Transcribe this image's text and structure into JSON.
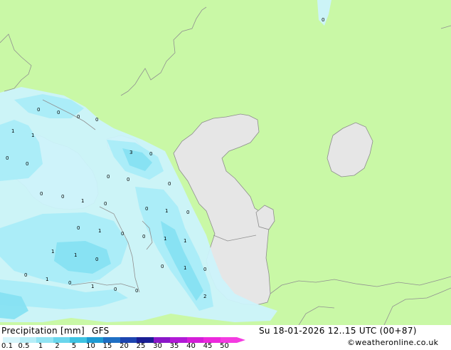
{
  "title": "Precipitation [mm]",
  "model": "GFS",
  "datetime": "Su 18-01-2026 12..15 UTC (00+87)",
  "credit": "©weatheronline.co.uk",
  "colorbar": {
    "labels": [
      "0.1",
      "0.5",
      "1",
      "2",
      "5",
      "10",
      "15",
      "20",
      "25",
      "30",
      "35",
      "40",
      "45",
      "50"
    ],
    "colors": [
      "#d6f5fb",
      "#b6eef8",
      "#92e4f3",
      "#6ad6ec",
      "#3fc3e2",
      "#1e9bd3",
      "#1f6fc4",
      "#1d45b0",
      "#1a1e94",
      "#8a17c8",
      "#b11ad6",
      "#d41ed8",
      "#ec28dd",
      "#f43be1"
    ]
  },
  "map_values": [
    {
      "label": "0"
    },
    {
      "label": "0"
    },
    {
      "label": "0"
    },
    {
      "label": "0"
    },
    {
      "label": "1"
    },
    {
      "label": "1"
    },
    {
      "label": "0"
    },
    {
      "label": "0"
    },
    {
      "label": "3"
    },
    {
      "label": "0"
    },
    {
      "label": "0"
    },
    {
      "label": "0"
    },
    {
      "label": "0"
    },
    {
      "label": "0"
    },
    {
      "label": "0"
    },
    {
      "label": "1"
    },
    {
      "label": "0"
    },
    {
      "label": "0"
    },
    {
      "label": "1"
    },
    {
      "label": "0"
    },
    {
      "label": "0"
    },
    {
      "label": "1"
    },
    {
      "label": "0"
    },
    {
      "label": "0"
    },
    {
      "label": "1"
    },
    {
      "label": "1"
    },
    {
      "label": "1"
    },
    {
      "label": "0"
    },
    {
      "label": "1"
    },
    {
      "label": "0"
    },
    {
      "label": "0"
    },
    {
      "label": "0"
    },
    {
      "label": "1"
    },
    {
      "label": "1"
    },
    {
      "label": "0"
    },
    {
      "label": "1"
    },
    {
      "label": "2"
    },
    {
      "label": "0"
    },
    {
      "label": "0"
    },
    {
      "label": "0"
    }
  ]
}
